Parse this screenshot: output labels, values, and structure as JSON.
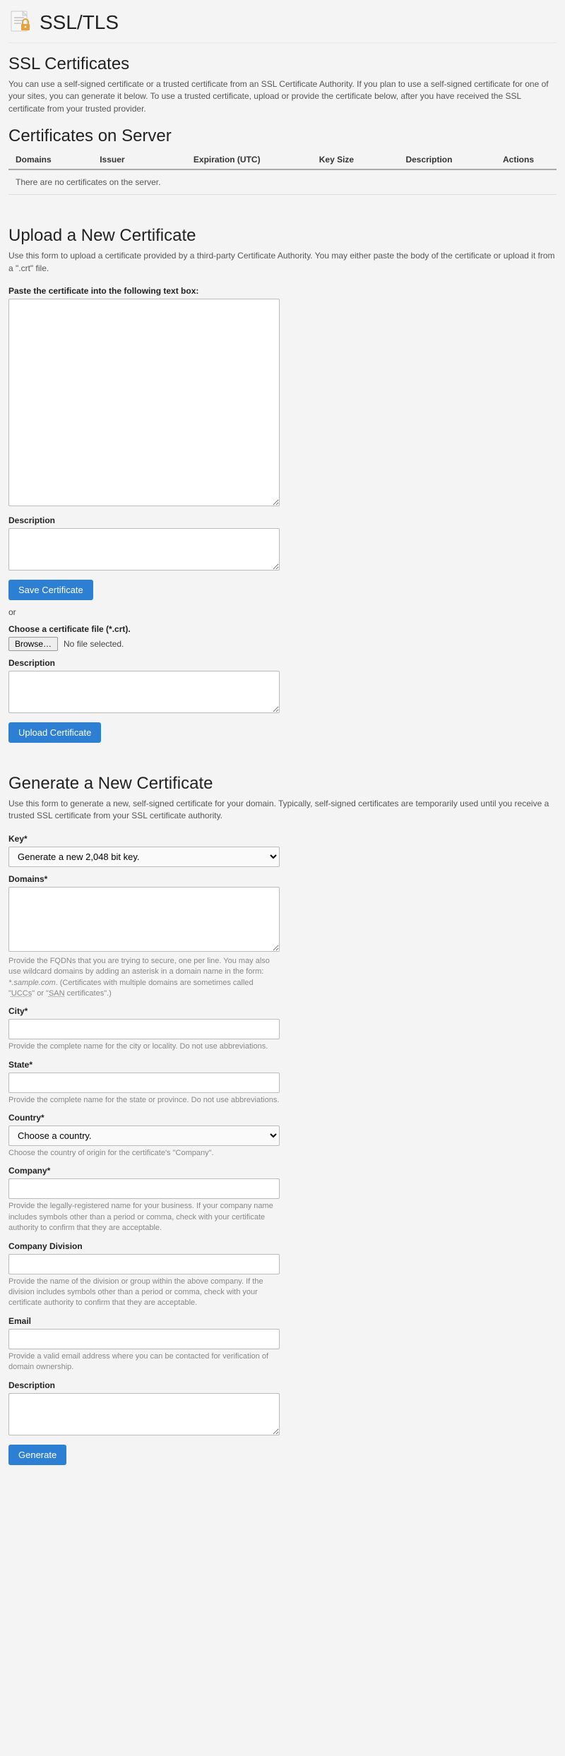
{
  "header": {
    "title": "SSL/TLS"
  },
  "ssl": {
    "heading": "SSL Certificates",
    "desc": "You can use a self-signed certificate or a trusted certificate from an SSL Certificate Authority. If you plan to use a self-signed certificate for one of your sites, you can generate it below. To use a trusted certificate, upload or provide the certificate below, after you have received the SSL certificate from your trusted provider."
  },
  "certs": {
    "heading": "Certificates on Server",
    "cols": {
      "domains": "Domains",
      "issuer": "Issuer",
      "expiration": "Expiration (UTC)",
      "keysize": "Key Size",
      "description": "Description",
      "actions": "Actions"
    },
    "empty": "There are no certificates on the server."
  },
  "upload": {
    "heading": "Upload a New Certificate",
    "desc": "Use this form to upload a certificate provided by a third-party Certificate Authority. You may either paste the body of the certificate or upload it from a \".crt\" file.",
    "paste_label": "Paste the certificate into the following text box:",
    "desc_label": "Description",
    "save_btn": "Save Certificate",
    "or": "or",
    "choose_label": "Choose a certificate file (*.crt).",
    "browse_btn": "Browse…",
    "no_file": "No file selected.",
    "desc2_label": "Description",
    "upload_btn": "Upload Certificate"
  },
  "gen": {
    "heading": "Generate a New Certificate",
    "desc": "Use this form to generate a new, self-signed certificate for your domain. Typically, self-signed certificates are temporarily used until you receive a trusted SSL certificate from your SSL certificate authority.",
    "key_label": "Key*",
    "key_value": "Generate a new 2,048 bit key.",
    "domains_label": "Domains*",
    "domains_help_1": "Provide the FQDNs that you are trying to secure, one per line. You may also use wildcard domains by adding an asterisk in a domain name in the form: ",
    "domains_help_sample": "*.sample.com",
    "domains_help_2": ". (Certificates with multiple domains are sometimes called \"",
    "domains_help_ucc": "UCCs",
    "domains_help_3": "\" or \"",
    "domains_help_san": "SAN",
    "domains_help_4": " certificates\".)",
    "city_label": "City*",
    "city_help": "Provide the complete name for the city or locality. Do not use abbreviations.",
    "state_label": "State*",
    "state_help": "Provide the complete name for the state or province. Do not use abbreviations.",
    "country_label": "Country*",
    "country_value": "Choose a country.",
    "country_help": "Choose the country of origin for the certificate's \"Company\".",
    "company_label": "Company*",
    "company_help": "Provide the legally-registered name for your business. If your company name includes symbols other than a period or comma, check with your certificate authority to confirm that they are acceptable.",
    "division_label": "Company Division",
    "division_help": "Provide the name of the division or group within the above company. If the division includes symbols other than a period or comma, check with your certificate authority to confirm that they are acceptable.",
    "email_label": "Email",
    "email_help": "Provide a valid email address where you can be contacted for verification of domain ownership.",
    "desc_label": "Description",
    "generate_btn": "Generate"
  }
}
